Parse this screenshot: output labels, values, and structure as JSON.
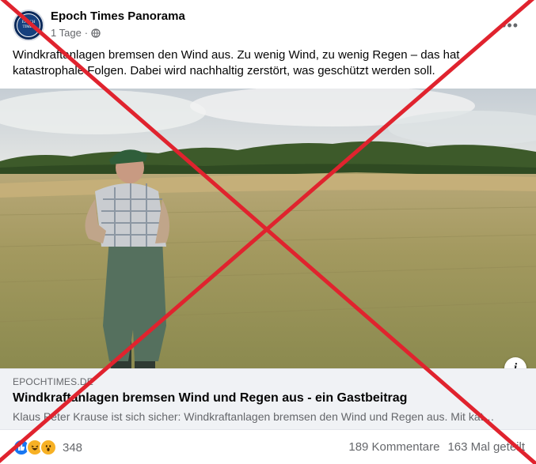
{
  "post": {
    "page_name": "Epoch Times Panorama",
    "timestamp": "1 Tage",
    "separator": "·",
    "privacy_icon": "globe-icon",
    "more_icon": "more-options-icon",
    "avatar_logo_text": "EPOCH TIMES",
    "text": "Windkraftanlagen bremsen den Wind aus. Zu wenig Wind, zu wenig Regen – das hat katastrophale Folgen. Dabei wird nachhaltig zerstört, was geschützt werden soll."
  },
  "link_preview": {
    "domain": "EPOCHTIMES.DE",
    "title": "Windkraftanlagen bremsen Wind und Regen aus - ein Gastbeitrag",
    "description": "Klaus Peter Krause ist sich sicher: Windkraftanlagen bremsen den Wind und Regen aus. Mit kat…",
    "info_label": "i"
  },
  "footer": {
    "reactions": [
      "like-reaction",
      "haha-reaction",
      "wow-reaction"
    ],
    "reaction_count": "348",
    "comments": "189 Kommentare",
    "shares": "163 Mal geteilt"
  },
  "overlay": {
    "cross_color": "#e0232e"
  }
}
